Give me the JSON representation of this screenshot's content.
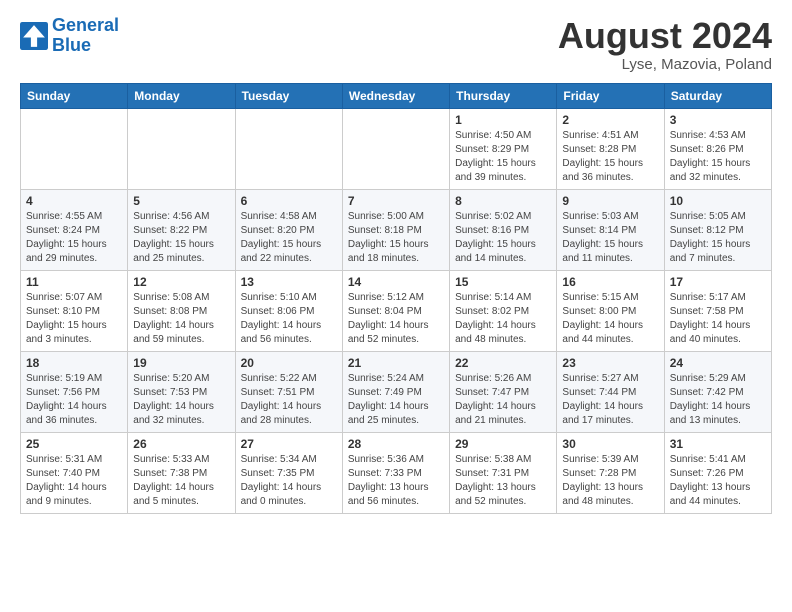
{
  "header": {
    "logo_line1": "General",
    "logo_line2": "Blue",
    "title": "August 2024",
    "subtitle": "Lyse, Mazovia, Poland"
  },
  "days_of_week": [
    "Sunday",
    "Monday",
    "Tuesday",
    "Wednesday",
    "Thursday",
    "Friday",
    "Saturday"
  ],
  "weeks": [
    [
      {
        "day": "",
        "info": ""
      },
      {
        "day": "",
        "info": ""
      },
      {
        "day": "",
        "info": ""
      },
      {
        "day": "",
        "info": ""
      },
      {
        "day": "1",
        "info": "Sunrise: 4:50 AM\nSunset: 8:29 PM\nDaylight: 15 hours\nand 39 minutes."
      },
      {
        "day": "2",
        "info": "Sunrise: 4:51 AM\nSunset: 8:28 PM\nDaylight: 15 hours\nand 36 minutes."
      },
      {
        "day": "3",
        "info": "Sunrise: 4:53 AM\nSunset: 8:26 PM\nDaylight: 15 hours\nand 32 minutes."
      }
    ],
    [
      {
        "day": "4",
        "info": "Sunrise: 4:55 AM\nSunset: 8:24 PM\nDaylight: 15 hours\nand 29 minutes."
      },
      {
        "day": "5",
        "info": "Sunrise: 4:56 AM\nSunset: 8:22 PM\nDaylight: 15 hours\nand 25 minutes."
      },
      {
        "day": "6",
        "info": "Sunrise: 4:58 AM\nSunset: 8:20 PM\nDaylight: 15 hours\nand 22 minutes."
      },
      {
        "day": "7",
        "info": "Sunrise: 5:00 AM\nSunset: 8:18 PM\nDaylight: 15 hours\nand 18 minutes."
      },
      {
        "day": "8",
        "info": "Sunrise: 5:02 AM\nSunset: 8:16 PM\nDaylight: 15 hours\nand 14 minutes."
      },
      {
        "day": "9",
        "info": "Sunrise: 5:03 AM\nSunset: 8:14 PM\nDaylight: 15 hours\nand 11 minutes."
      },
      {
        "day": "10",
        "info": "Sunrise: 5:05 AM\nSunset: 8:12 PM\nDaylight: 15 hours\nand 7 minutes."
      }
    ],
    [
      {
        "day": "11",
        "info": "Sunrise: 5:07 AM\nSunset: 8:10 PM\nDaylight: 15 hours\nand 3 minutes."
      },
      {
        "day": "12",
        "info": "Sunrise: 5:08 AM\nSunset: 8:08 PM\nDaylight: 14 hours\nand 59 minutes."
      },
      {
        "day": "13",
        "info": "Sunrise: 5:10 AM\nSunset: 8:06 PM\nDaylight: 14 hours\nand 56 minutes."
      },
      {
        "day": "14",
        "info": "Sunrise: 5:12 AM\nSunset: 8:04 PM\nDaylight: 14 hours\nand 52 minutes."
      },
      {
        "day": "15",
        "info": "Sunrise: 5:14 AM\nSunset: 8:02 PM\nDaylight: 14 hours\nand 48 minutes."
      },
      {
        "day": "16",
        "info": "Sunrise: 5:15 AM\nSunset: 8:00 PM\nDaylight: 14 hours\nand 44 minutes."
      },
      {
        "day": "17",
        "info": "Sunrise: 5:17 AM\nSunset: 7:58 PM\nDaylight: 14 hours\nand 40 minutes."
      }
    ],
    [
      {
        "day": "18",
        "info": "Sunrise: 5:19 AM\nSunset: 7:56 PM\nDaylight: 14 hours\nand 36 minutes."
      },
      {
        "day": "19",
        "info": "Sunrise: 5:20 AM\nSunset: 7:53 PM\nDaylight: 14 hours\nand 32 minutes."
      },
      {
        "day": "20",
        "info": "Sunrise: 5:22 AM\nSunset: 7:51 PM\nDaylight: 14 hours\nand 28 minutes."
      },
      {
        "day": "21",
        "info": "Sunrise: 5:24 AM\nSunset: 7:49 PM\nDaylight: 14 hours\nand 25 minutes."
      },
      {
        "day": "22",
        "info": "Sunrise: 5:26 AM\nSunset: 7:47 PM\nDaylight: 14 hours\nand 21 minutes."
      },
      {
        "day": "23",
        "info": "Sunrise: 5:27 AM\nSunset: 7:44 PM\nDaylight: 14 hours\nand 17 minutes."
      },
      {
        "day": "24",
        "info": "Sunrise: 5:29 AM\nSunset: 7:42 PM\nDaylight: 14 hours\nand 13 minutes."
      }
    ],
    [
      {
        "day": "25",
        "info": "Sunrise: 5:31 AM\nSunset: 7:40 PM\nDaylight: 14 hours\nand 9 minutes."
      },
      {
        "day": "26",
        "info": "Sunrise: 5:33 AM\nSunset: 7:38 PM\nDaylight: 14 hours\nand 5 minutes."
      },
      {
        "day": "27",
        "info": "Sunrise: 5:34 AM\nSunset: 7:35 PM\nDaylight: 14 hours\nand 0 minutes."
      },
      {
        "day": "28",
        "info": "Sunrise: 5:36 AM\nSunset: 7:33 PM\nDaylight: 13 hours\nand 56 minutes."
      },
      {
        "day": "29",
        "info": "Sunrise: 5:38 AM\nSunset: 7:31 PM\nDaylight: 13 hours\nand 52 minutes."
      },
      {
        "day": "30",
        "info": "Sunrise: 5:39 AM\nSunset: 7:28 PM\nDaylight: 13 hours\nand 48 minutes."
      },
      {
        "day": "31",
        "info": "Sunrise: 5:41 AM\nSunset: 7:26 PM\nDaylight: 13 hours\nand 44 minutes."
      }
    ]
  ]
}
